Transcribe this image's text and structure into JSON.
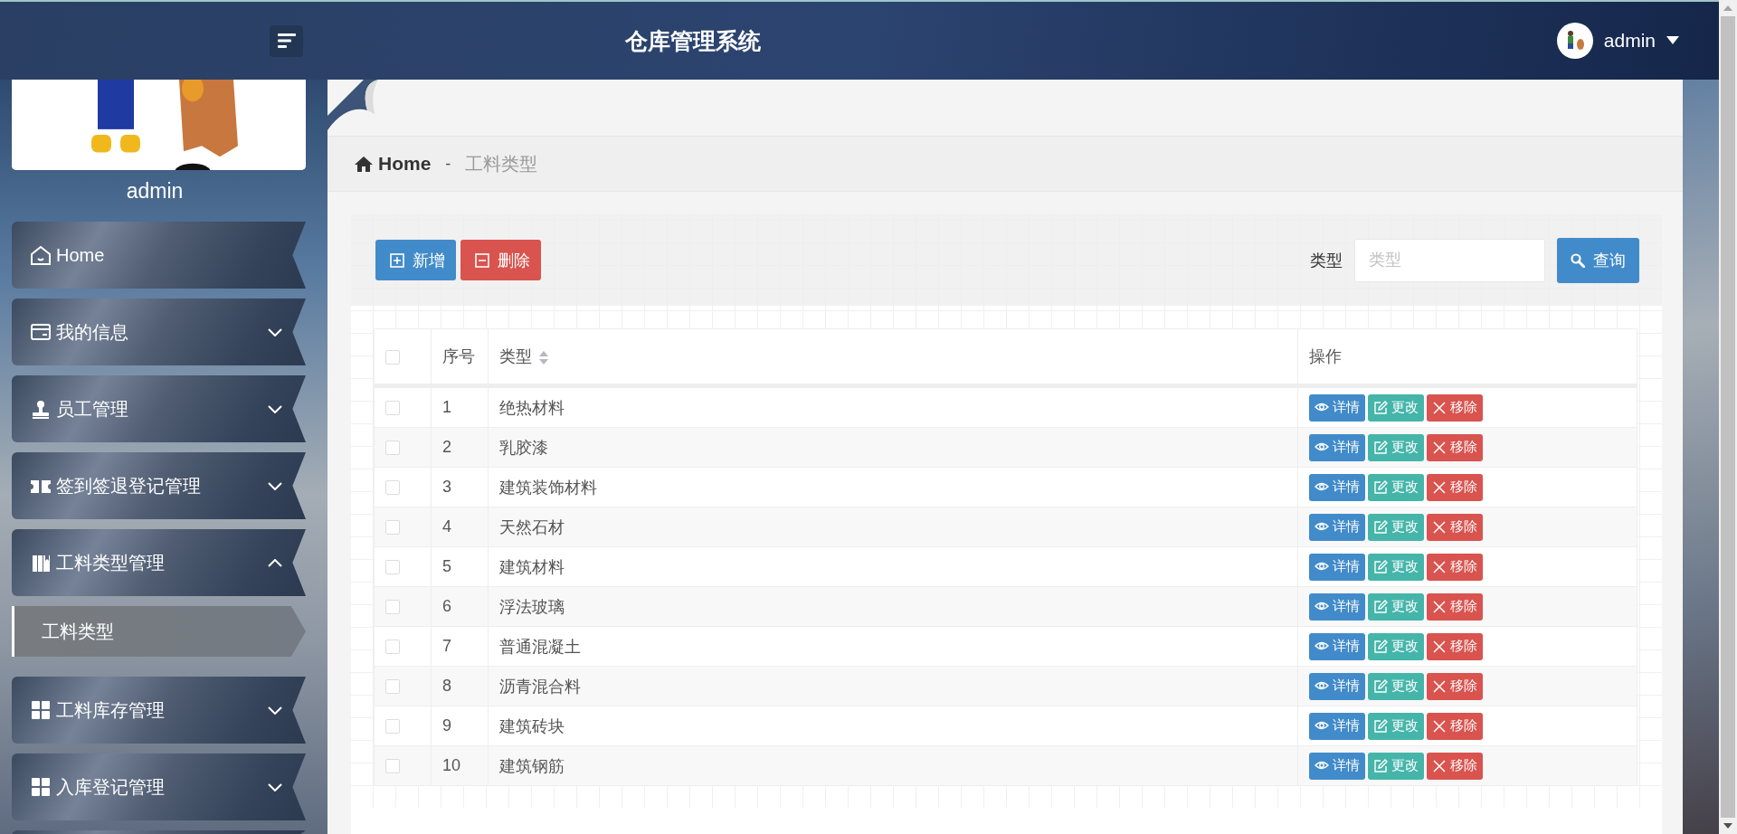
{
  "topbar": {
    "title": "仓库管理系统",
    "user": "admin"
  },
  "sidebar": {
    "username": "admin",
    "items": [
      {
        "label": "Home",
        "kind": "link"
      },
      {
        "label": "我的信息",
        "kind": "group",
        "expanded": false
      },
      {
        "label": "员工管理",
        "kind": "group",
        "expanded": false
      },
      {
        "label": "签到签退登记管理",
        "kind": "group",
        "expanded": false
      },
      {
        "label": "工料类型管理",
        "kind": "group",
        "expanded": true,
        "children": [
          {
            "label": "工料类型",
            "selected": true
          }
        ]
      },
      {
        "label": "工料库存管理",
        "kind": "group",
        "expanded": false
      },
      {
        "label": "入库登记管理",
        "kind": "group",
        "expanded": false
      }
    ]
  },
  "breadcrumb": {
    "home": "Home",
    "separator": "-",
    "current": "工料类型"
  },
  "toolbar": {
    "buttons": [
      {
        "kind": "add",
        "label": "新增"
      },
      {
        "kind": "delete",
        "label": "删除"
      }
    ],
    "filter": {
      "label": "类型",
      "placeholder": "类型"
    },
    "search_button": "查询"
  },
  "table": {
    "select_all_checked": false,
    "columns": [
      {
        "label": "序号",
        "sortable": false
      },
      {
        "label": "类型",
        "sortable": true
      },
      {
        "label": "操作",
        "sortable": false
      }
    ],
    "rows": [
      {
        "index": "1",
        "type": "绝热材料",
        "checked": false,
        "actions": [
          {
            "kind": "view",
            "label": "详情"
          },
          {
            "kind": "edit",
            "label": "更改"
          },
          {
            "kind": "remove",
            "label": "移除"
          }
        ]
      },
      {
        "index": "2",
        "type": "乳胶漆",
        "checked": false,
        "actions": [
          {
            "kind": "view",
            "label": "详情"
          },
          {
            "kind": "edit",
            "label": "更改"
          },
          {
            "kind": "remove",
            "label": "移除"
          }
        ]
      },
      {
        "index": "3",
        "type": "建筑装饰材料",
        "checked": false,
        "actions": [
          {
            "kind": "view",
            "label": "详情"
          },
          {
            "kind": "edit",
            "label": "更改"
          },
          {
            "kind": "remove",
            "label": "移除"
          }
        ]
      },
      {
        "index": "4",
        "type": "天然石材",
        "checked": false,
        "actions": [
          {
            "kind": "view",
            "label": "详情"
          },
          {
            "kind": "edit",
            "label": "更改"
          },
          {
            "kind": "remove",
            "label": "移除"
          }
        ]
      },
      {
        "index": "5",
        "type": "建筑材料",
        "checked": false,
        "actions": [
          {
            "kind": "view",
            "label": "详情"
          },
          {
            "kind": "edit",
            "label": "更改"
          },
          {
            "kind": "remove",
            "label": "移除"
          }
        ]
      },
      {
        "index": "6",
        "type": "浮法玻璃",
        "checked": false,
        "actions": [
          {
            "kind": "view",
            "label": "详情"
          },
          {
            "kind": "edit",
            "label": "更改"
          },
          {
            "kind": "remove",
            "label": "移除"
          }
        ]
      },
      {
        "index": "7",
        "type": "普通混凝土",
        "checked": false,
        "actions": [
          {
            "kind": "view",
            "label": "详情"
          },
          {
            "kind": "edit",
            "label": "更改"
          },
          {
            "kind": "remove",
            "label": "移除"
          }
        ]
      },
      {
        "index": "8",
        "type": "沥青混合料",
        "checked": false,
        "actions": [
          {
            "kind": "view",
            "label": "详情"
          },
          {
            "kind": "edit",
            "label": "更改"
          },
          {
            "kind": "remove",
            "label": "移除"
          }
        ]
      },
      {
        "index": "9",
        "type": "建筑砖块",
        "checked": false,
        "actions": [
          {
            "kind": "view",
            "label": "详情"
          },
          {
            "kind": "edit",
            "label": "更改"
          },
          {
            "kind": "remove",
            "label": "移除"
          }
        ]
      },
      {
        "index": "10",
        "type": "建筑钢筋",
        "checked": false,
        "actions": [
          {
            "kind": "view",
            "label": "详情"
          },
          {
            "kind": "edit",
            "label": "更改"
          },
          {
            "kind": "remove",
            "label": "移除"
          }
        ]
      }
    ]
  }
}
